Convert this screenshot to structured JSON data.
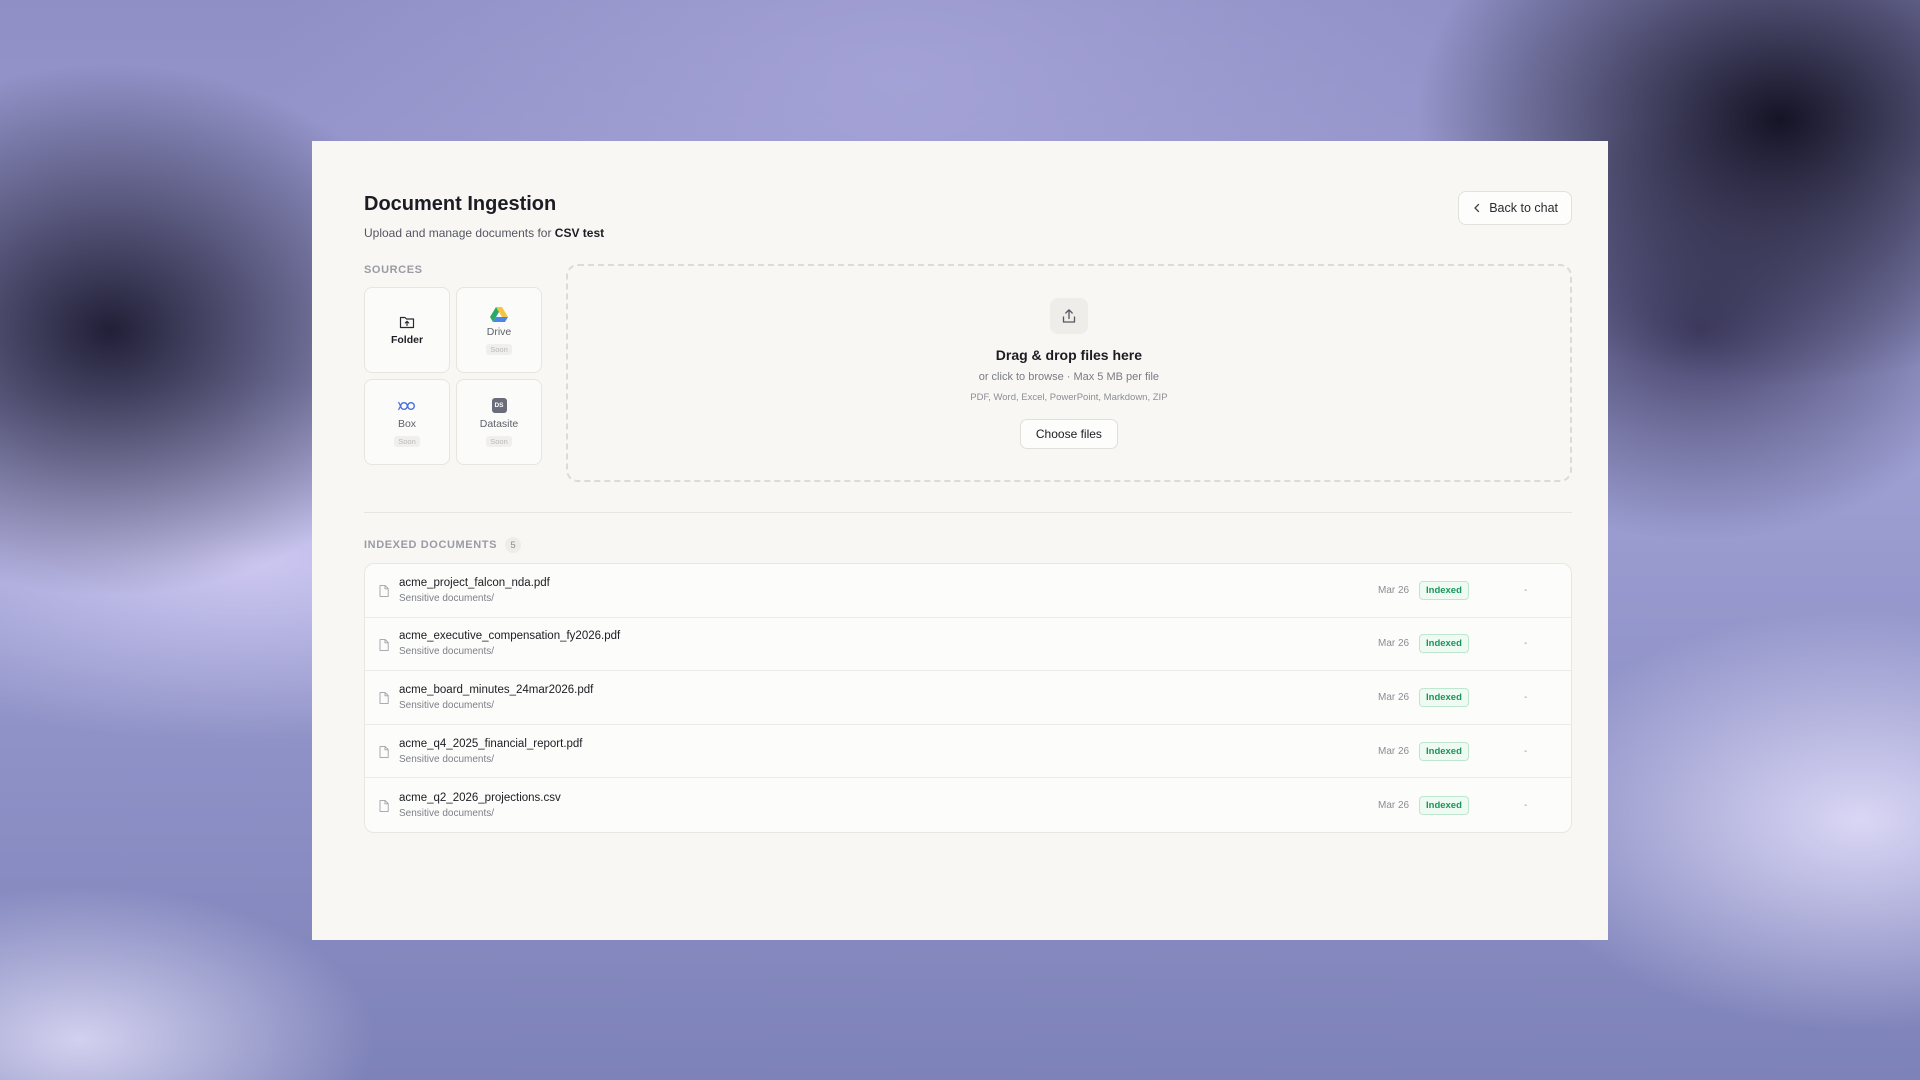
{
  "header": {
    "title": "Document Ingestion",
    "subtitle_prefix": "Upload and manage documents for",
    "project_name": "CSV test",
    "back_label": "Back to chat"
  },
  "sources": {
    "label": "SOURCES",
    "items": [
      {
        "name": "Folder",
        "icon": "folder-upload-icon",
        "soon": ""
      },
      {
        "name": "Drive",
        "icon": "google-drive-icon",
        "soon": "Soon"
      },
      {
        "name": "Box",
        "icon": "box-icon",
        "soon": "Soon"
      },
      {
        "name": "Datasite",
        "icon": "datasite-icon",
        "icon_text": "DS",
        "soon": "Soon"
      }
    ]
  },
  "dropzone": {
    "title": "Drag & drop files here",
    "subtitle": "or click to browse · Max 5 MB per file",
    "types": "PDF, Word, Excel, PowerPoint, Markdown, ZIP",
    "button": "Choose files"
  },
  "documents": {
    "label": "INDEXED DOCUMENTS",
    "count": "5",
    "rows": [
      {
        "name": "acme_project_falcon_nda.pdf",
        "path": "Sensitive documents/",
        "date": "Mar 26",
        "status": "Indexed",
        "extra": "-"
      },
      {
        "name": "acme_executive_compensation_fy2026.pdf",
        "path": "Sensitive documents/",
        "date": "Mar 26",
        "status": "Indexed",
        "extra": "-"
      },
      {
        "name": "acme_board_minutes_24mar2026.pdf",
        "path": "Sensitive documents/",
        "date": "Mar 26",
        "status": "Indexed",
        "extra": "-"
      },
      {
        "name": "acme_q4_2025_financial_report.pdf",
        "path": "Sensitive documents/",
        "date": "Mar 26",
        "status": "Indexed",
        "extra": "-"
      },
      {
        "name": "acme_q2_2026_projections.csv",
        "path": "Sensitive documents/",
        "date": "Mar 26",
        "status": "Indexed",
        "extra": "-"
      }
    ]
  },
  "colors": {
    "accent_green": "#19955a",
    "panel_bg": "#f8f7f3"
  }
}
